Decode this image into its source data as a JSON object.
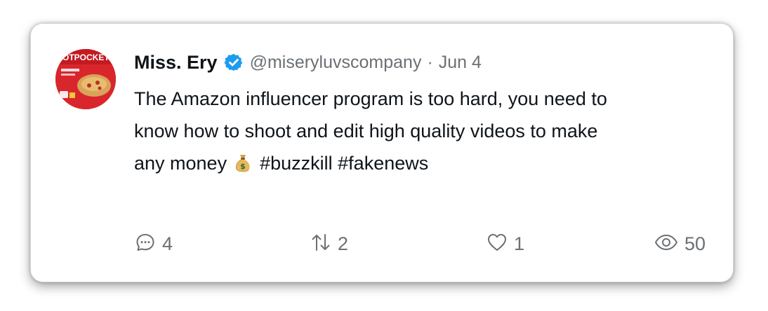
{
  "post": {
    "author": {
      "name": "Miss. Ery",
      "handle": "@miseryluvscompany",
      "verified": true,
      "avatar_icon": "hot-pockets-box-avatar",
      "avatar_text": "HOTPOCKETS"
    },
    "separator": "·",
    "date": "Jun 4",
    "text_lines": [
      "The Amazon influencer program is too hard, you need to",
      "know how to shoot and edit high quality videos to make",
      "any money"
    ],
    "emoji": "money-bag",
    "hashtags": "#buzzkill #fakenews",
    "stats": {
      "replies": "4",
      "reposts": "2",
      "likes": "1",
      "views": "50"
    }
  },
  "colors": {
    "text": "#0f1419",
    "muted": "#6b7075",
    "verified": "#1d9bf0",
    "card_border": "#d8d8d8"
  }
}
